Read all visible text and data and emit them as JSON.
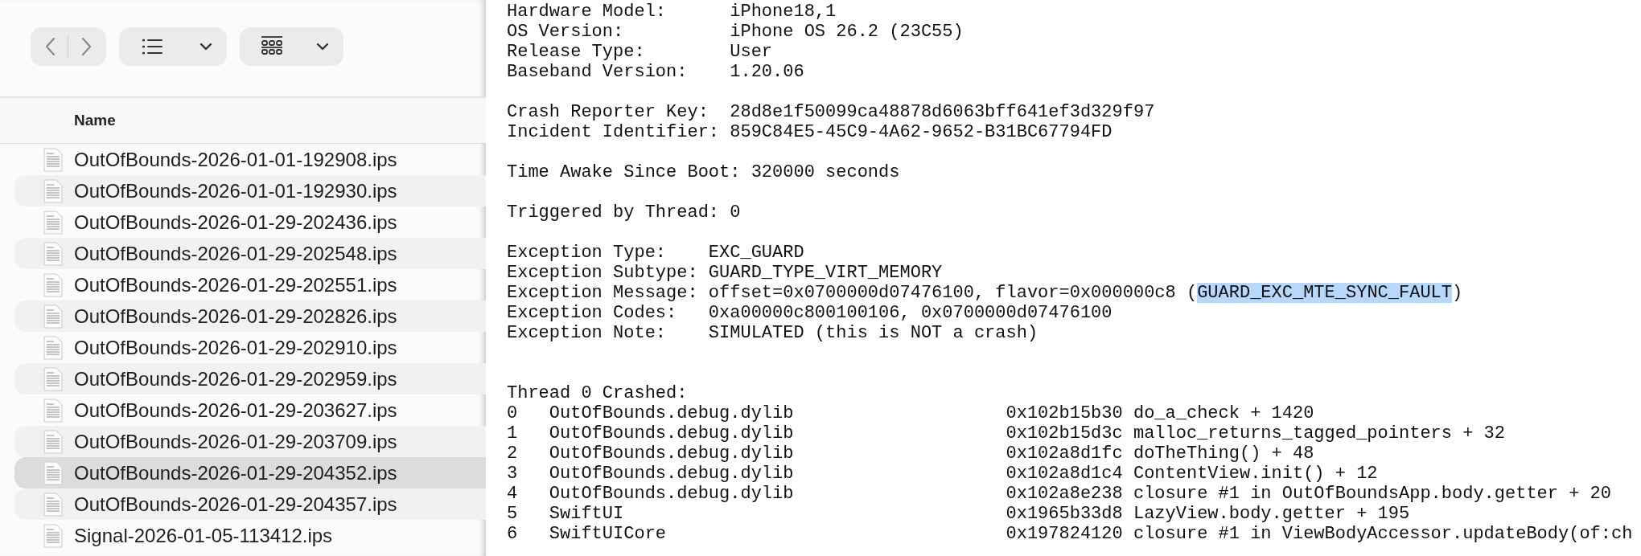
{
  "toolbar": {
    "buttons": [
      {
        "kind": "nav"
      },
      {
        "kind": "list-view"
      },
      {
        "kind": "group"
      }
    ]
  },
  "file_list": {
    "column_header": "Name",
    "rows": [
      {
        "name": "OutOfBounds-2026-01-01-192908.ips",
        "selected": false
      },
      {
        "name": "OutOfBounds-2026-01-01-192930.ips",
        "selected": false
      },
      {
        "name": "OutOfBounds-2026-01-29-202436.ips",
        "selected": false
      },
      {
        "name": "OutOfBounds-2026-01-29-202548.ips",
        "selected": false
      },
      {
        "name": "OutOfBounds-2026-01-29-202551.ips",
        "selected": false
      },
      {
        "name": "OutOfBounds-2026-01-29-202826.ips",
        "selected": false
      },
      {
        "name": "OutOfBounds-2026-01-29-202910.ips",
        "selected": false
      },
      {
        "name": "OutOfBounds-2026-01-29-202959.ips",
        "selected": false
      },
      {
        "name": "OutOfBounds-2026-01-29-203627.ips",
        "selected": false
      },
      {
        "name": "OutOfBounds-2026-01-29-203709.ips",
        "selected": false
      },
      {
        "name": "OutOfBounds-2026-01-29-204352.ips",
        "selected": true
      },
      {
        "name": "OutOfBounds-2026-01-29-204357.ips",
        "selected": false
      },
      {
        "name": "Signal-2026-01-05-113412.ips",
        "selected": false
      }
    ]
  },
  "crash_log": {
    "blocks": [
      {
        "kind": "info",
        "lines": [
          {
            "text": "Hardware Model:      iPhone18,1"
          },
          {
            "text": "OS Version:          iPhone OS 26.2 (23C55)"
          },
          {
            "text": "Release Type:        User"
          },
          {
            "text": "Baseband Version:    1.20.06"
          }
        ]
      },
      {
        "kind": "info",
        "lines": [
          {
            "text": "Crash Reporter Key:  28d8e1f50099ca48878d6063bff641ef3d329f97"
          },
          {
            "text": "Incident Identifier: 859C84E5-45C9-4A62-9652-B31BC67794FD"
          }
        ]
      },
      {
        "kind": "info",
        "lines": [
          {
            "text": "Time Awake Since Boot: 320000 seconds"
          }
        ]
      },
      {
        "kind": "info",
        "lines": [
          {
            "text": "Triggered by Thread: 0"
          }
        ]
      },
      {
        "kind": "info",
        "lines": [
          {
            "text": "Exception Type:    EXC_GUARD"
          },
          {
            "text": "Exception Subtype: GUARD_TYPE_VIRT_MEMORY"
          },
          {
            "text": "Exception Message: offset=0x0700000d07476100, flavor=0x000000c8 (",
            "selected_text": "GUARD_EXC_MTE_SYNC_FAULT",
            "text_after": ")"
          },
          {
            "text": "Exception Codes:   0xa00000c800100106, 0x0700000d07476100"
          },
          {
            "text": "Exception Note:    SIMULATED (this is NOT a crash)"
          }
        ]
      },
      {
        "kind": "backtrace",
        "lines": [
          {
            "text": "Thread 0 Crashed:"
          },
          {
            "text": "0   OutOfBounds.debug.dylib                    0x102b15b30 do_a_check + 1420"
          },
          {
            "text": "1   OutOfBounds.debug.dylib                    0x102b15d3c malloc_returns_tagged_pointers + 32"
          },
          {
            "text": "2   OutOfBounds.debug.dylib                    0x102a8d1fc doTheThing() + 48"
          },
          {
            "text": "3   OutOfBounds.debug.dylib                    0x102a8d1c4 ContentView.init() + 12"
          },
          {
            "text": "4   OutOfBounds.debug.dylib                    0x102a8e238 closure #1 in OutOfBoundsApp.body.getter + 20"
          },
          {
            "text": "5   SwiftUI                                    0x1965b33d8 LazyView.body.getter + 195"
          },
          {
            "text": "6   SwiftUICore                                0x197824120 closure #1 in ViewBodyAccessor.updateBody(of:ch"
          }
        ]
      }
    ]
  }
}
